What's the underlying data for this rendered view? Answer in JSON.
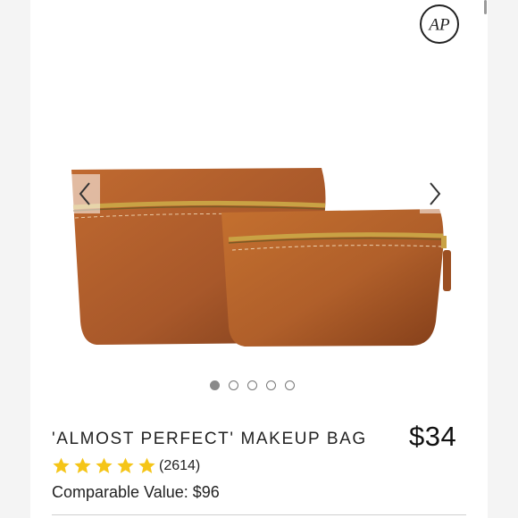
{
  "brand": {
    "logo_text": "AP",
    "logo_icon": "brand-monogram-icon"
  },
  "gallery": {
    "image_subject": "two-leather-makeup-bags-image",
    "prev_icon": "chevron-left-icon",
    "next_icon": "chevron-right-icon",
    "slide_count": 5,
    "active_slide": 1
  },
  "product": {
    "title": "'ALMOST PERFECT' MAKEUP BAG",
    "price": "$34",
    "rating_stars": 5,
    "review_count": "(2614)",
    "comparable_value": "Comparable Value: $96"
  },
  "colors": {
    "star": "#F5C518",
    "leather": "#B0602C",
    "zipper": "#C9A244",
    "background": "#F4F4F4"
  }
}
